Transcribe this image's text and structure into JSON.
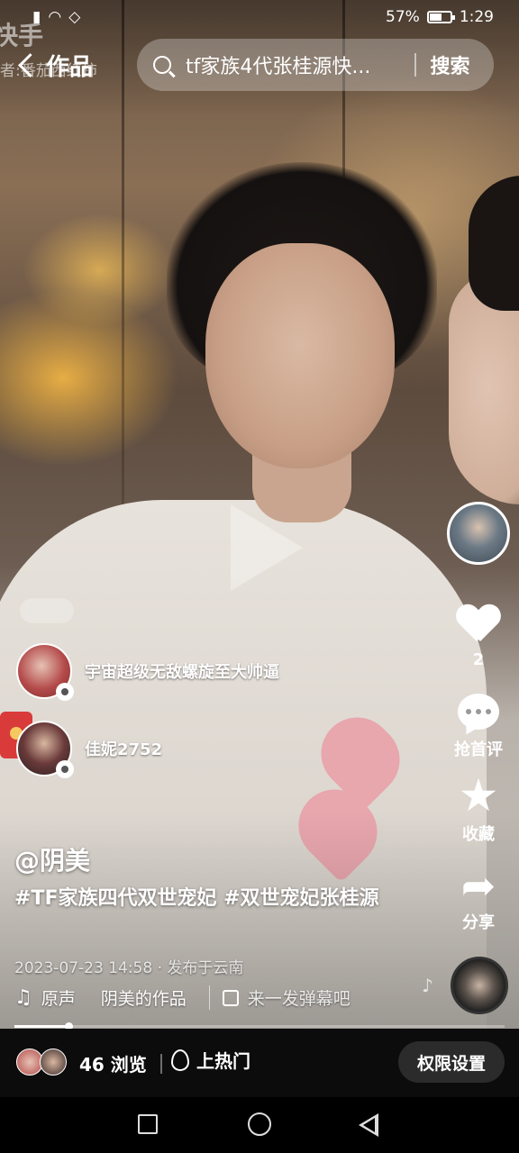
{
  "status_bar": {
    "battery": "57%",
    "battery_level": 0.57,
    "time": "1:29",
    "left_icons": [
      "signal-icon",
      "wifi-icon",
      "data-icon"
    ]
  },
  "header": {
    "watermark": "快手",
    "author_watermark": "者:番茄西红柿",
    "back_label": "作品",
    "search_text": "tf家族4代张桂源快...",
    "search_button": "搜索"
  },
  "live_viewers": [
    {
      "name": "宇宙超级无敌螺旋至大帅逼"
    },
    {
      "name": "佳妮2752"
    }
  ],
  "actions": {
    "likes": "2",
    "comment_label": "抢首评",
    "favorite_label": "收藏",
    "share_label": "分享"
  },
  "post": {
    "author": "@阴美",
    "hashtags": "#TF家族四代双世宠妃 #双世宠妃张桂源",
    "meta": "2023-07-23 14:58 · 发布于云南",
    "music_origin": "原声",
    "music_title": "阴美的作品",
    "danmu_placeholder": "来一发弹幕吧"
  },
  "progress": {
    "fraction": 0.11
  },
  "bottom_bar": {
    "views": "46 浏览",
    "hot_label": "上热门",
    "permission_button": "权限设置"
  },
  "colors": {
    "accent_red": "#d93b3b",
    "bottom_bg": "#0c0c0c"
  }
}
